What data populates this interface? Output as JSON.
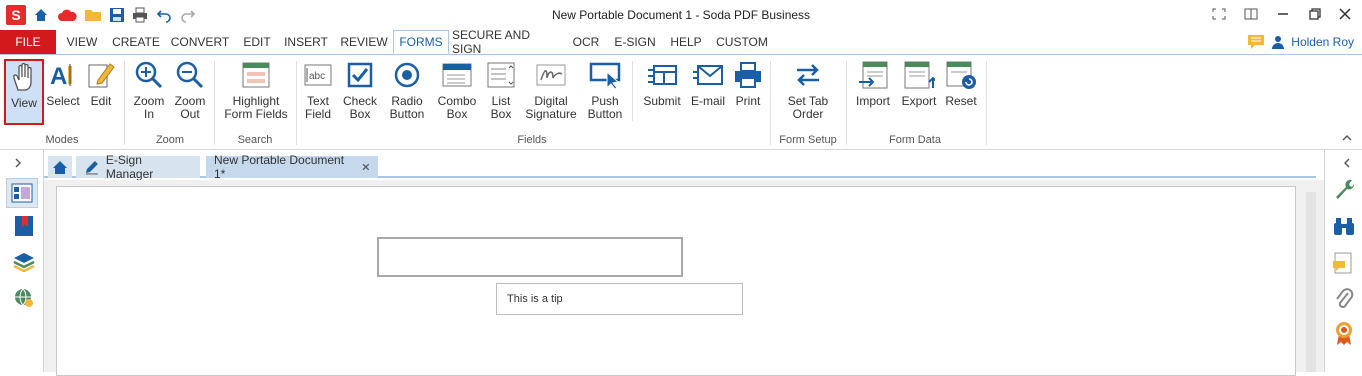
{
  "window": {
    "title": "New Portable Document 1   -   Soda PDF Business",
    "logo_letter": "S"
  },
  "menu": {
    "file": "FILE",
    "tabs": [
      "VIEW",
      "CREATE",
      "CONVERT",
      "EDIT",
      "INSERT",
      "REVIEW",
      "FORMS",
      "SECURE AND SIGN",
      "OCR",
      "E-SIGN",
      "HELP",
      "CUSTOM"
    ],
    "active_tab": "FORMS",
    "user": "Holden Roy"
  },
  "ribbon": {
    "buttons": {
      "view": "View",
      "select": "Select",
      "edit": "Edit",
      "zoom_in": "Zoom In",
      "zoom_out": "Zoom Out",
      "highlight": "Highlight Form Fields",
      "text_field": "Text Field",
      "check_box": "Check Box",
      "radio_button": "Radio Button",
      "combo_box": "Combo Box",
      "list_box": "List Box",
      "digital_signature": "Digital Signature",
      "push_button": "Push Button",
      "submit": "Submit",
      "email": "E-mail",
      "print": "Print",
      "set_tab_order": "Set Tab Order",
      "import": "Import",
      "export": "Export",
      "reset": "Reset"
    },
    "groups": {
      "modes": "Modes",
      "zoom": "Zoom",
      "search": "Search",
      "fields": "Fields",
      "form_setup": "Form Setup",
      "form_data": "Form Data"
    },
    "icon_text_abc": "abc"
  },
  "doc_tabs": {
    "esign": "E-Sign Manager",
    "document": "New Portable Document 1*"
  },
  "document": {
    "tooltip": "This is a tip"
  }
}
